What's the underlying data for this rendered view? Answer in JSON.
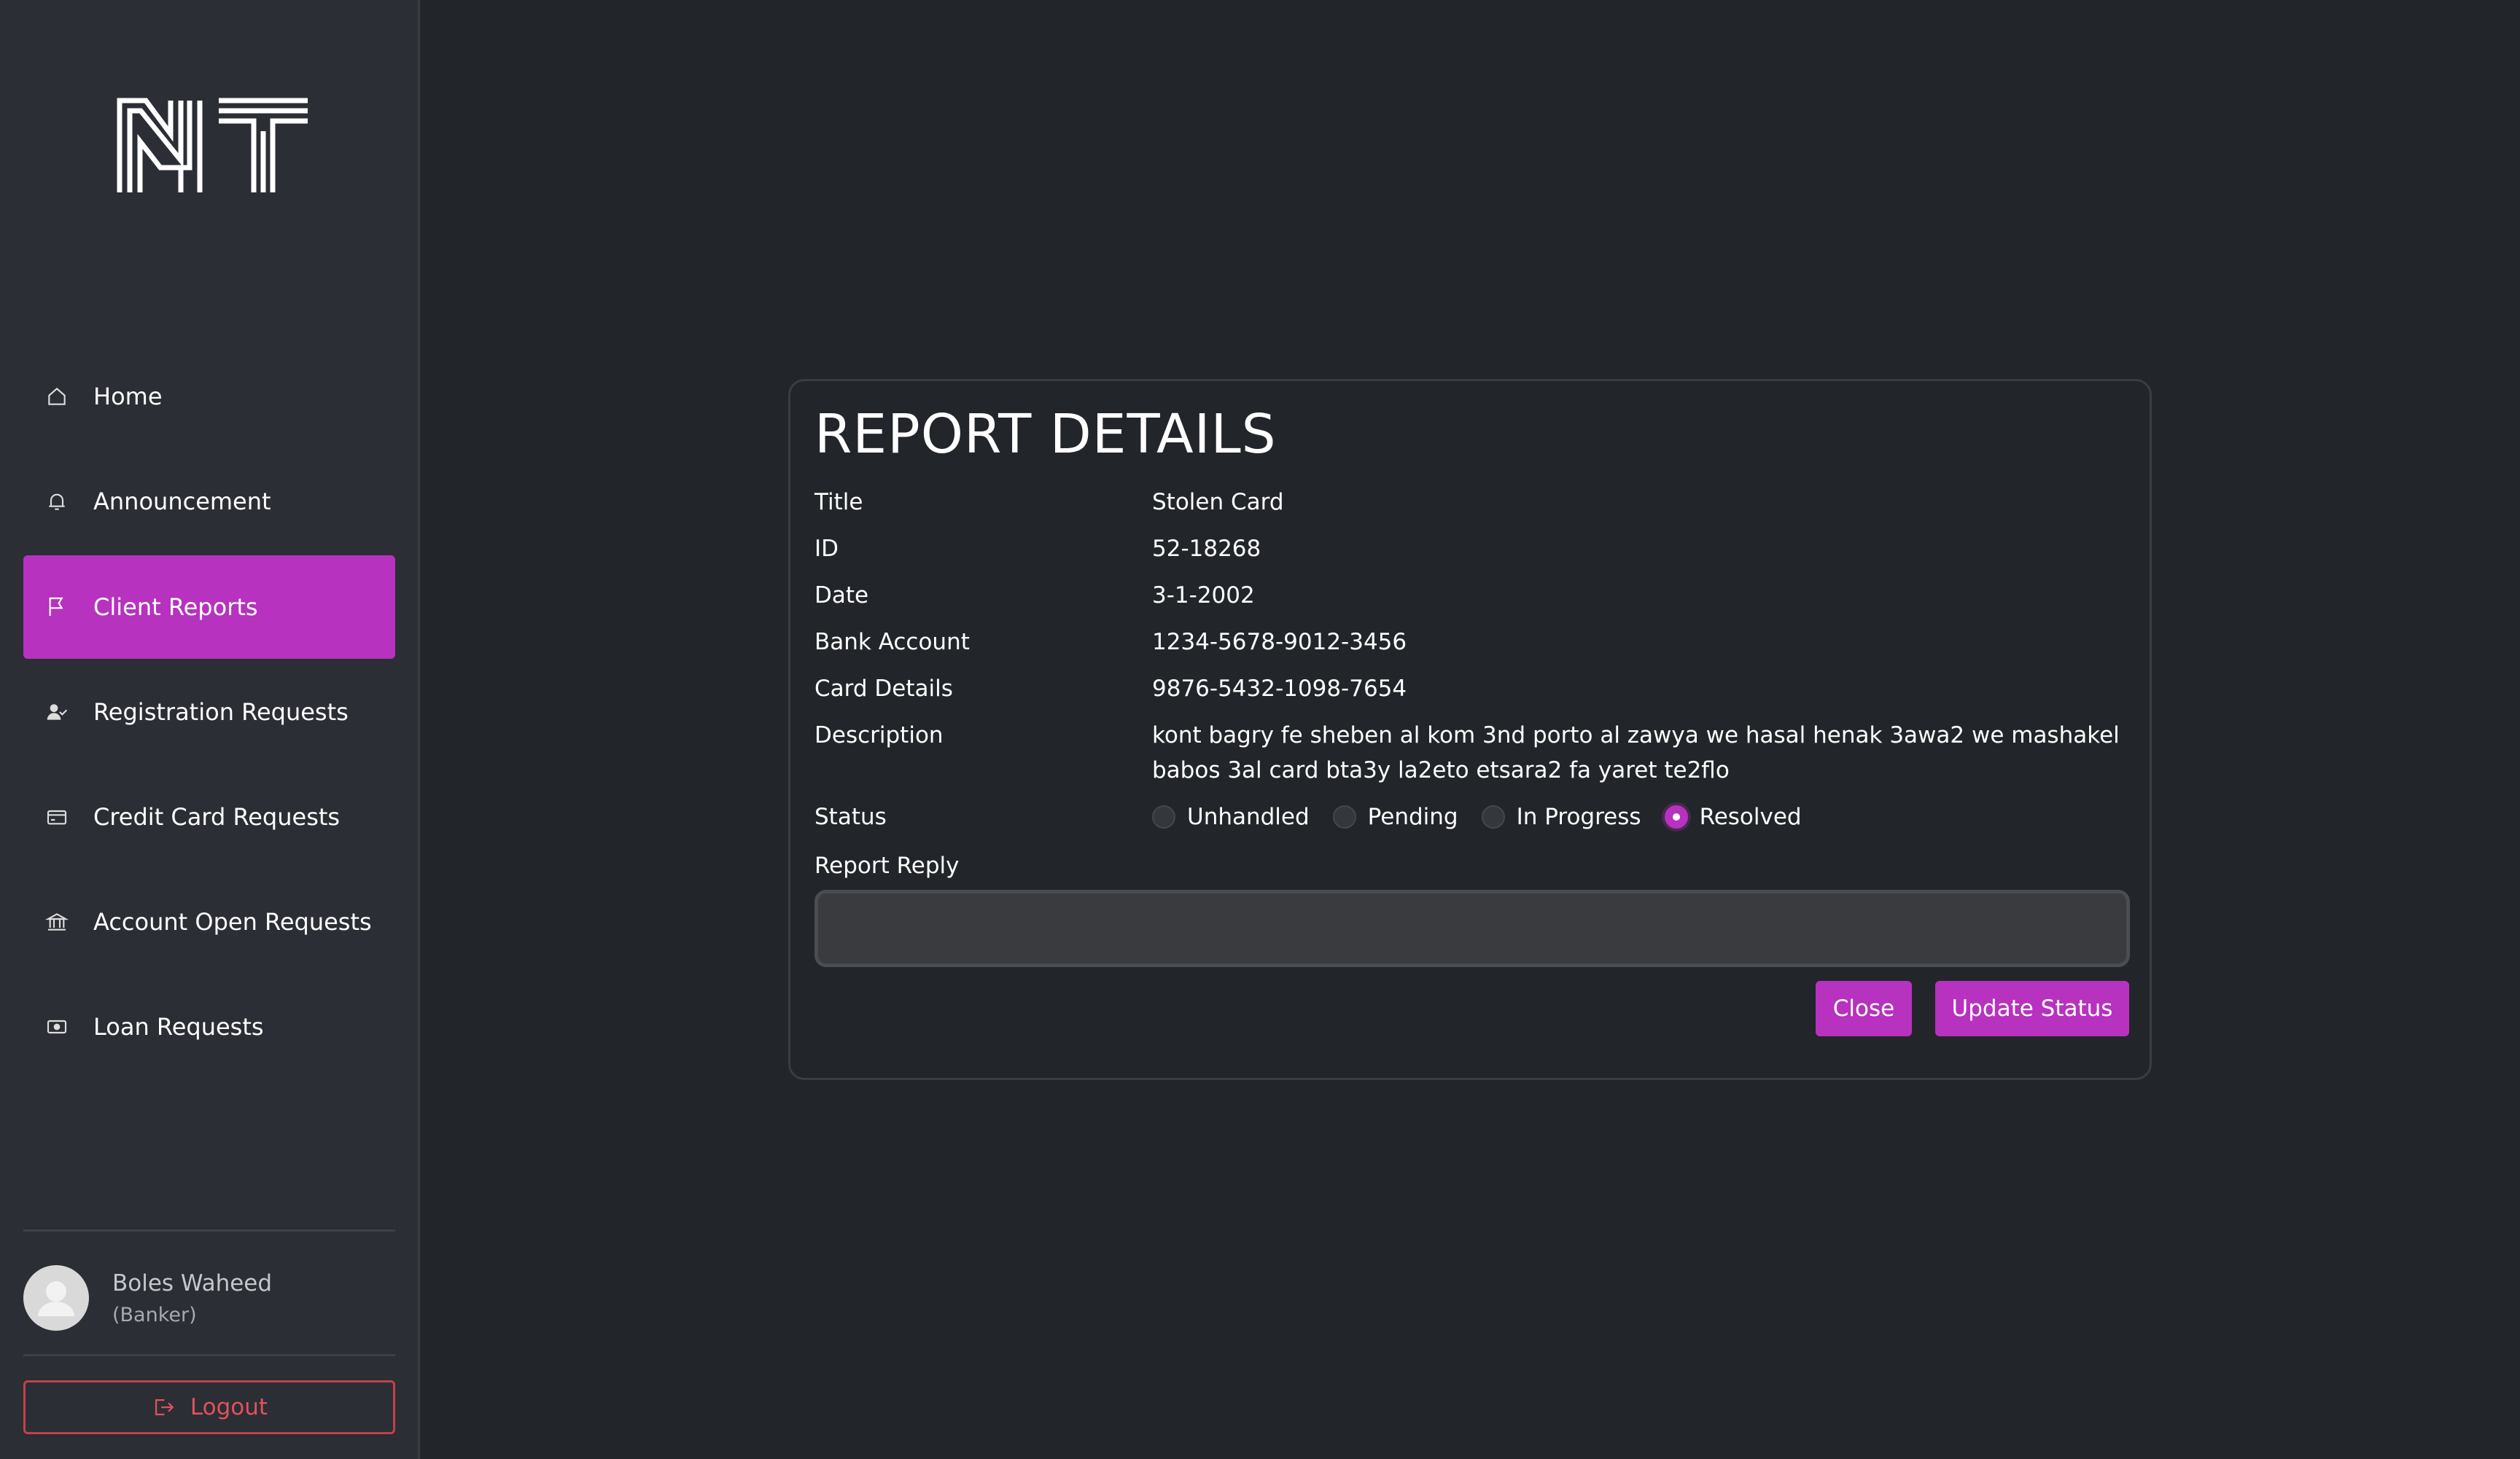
{
  "sidebar": {
    "logo_text": "NT",
    "nav": [
      {
        "label": "Home",
        "icon": "home-icon",
        "active": false
      },
      {
        "label": "Announcement",
        "icon": "bell-icon",
        "active": false
      },
      {
        "label": "Client Reports",
        "icon": "flag-icon",
        "active": true
      },
      {
        "label": "Registration Requests",
        "icon": "user-check-icon",
        "active": false
      },
      {
        "label": "Credit Card Requests",
        "icon": "credit-card-icon",
        "active": false
      },
      {
        "label": "Account Open Requests",
        "icon": "bank-icon",
        "active": false
      },
      {
        "label": "Loan Requests",
        "icon": "cash-icon",
        "active": false
      }
    ],
    "user": {
      "name": "Boles Waheed",
      "role": "(Banker)"
    },
    "logout_label": "Logout"
  },
  "report": {
    "heading": "REPORT DETAILS",
    "fields": [
      {
        "label": "Title",
        "value": "Stolen Card"
      },
      {
        "label": "ID",
        "value": "52-18268"
      },
      {
        "label": "Date",
        "value": "3-1-2002"
      },
      {
        "label": "Bank Account",
        "value": "1234-5678-9012-3456"
      },
      {
        "label": "Card Details",
        "value": "9876-5432-1098-7654"
      },
      {
        "label": "Description",
        "value": "kont bagry fe sheben al kom 3nd porto al zawya we hasal henak 3awa2 we mashakel babos 3al card bta3y la2eto etsara2 fa yaret te2flo"
      }
    ],
    "status_label": "Status",
    "status_options": [
      "Unhandled",
      "Pending",
      "In Progress",
      "Resolved"
    ],
    "status_selected": "Resolved",
    "reply_label": "Report Reply",
    "reply_value": "",
    "reply_placeholder": "",
    "close_label": "Close",
    "update_label": "Update Status"
  },
  "colors": {
    "accent": "#b732be",
    "background": "#22252a",
    "sidebar": "#2b2e34",
    "logout": "#e0525c"
  }
}
